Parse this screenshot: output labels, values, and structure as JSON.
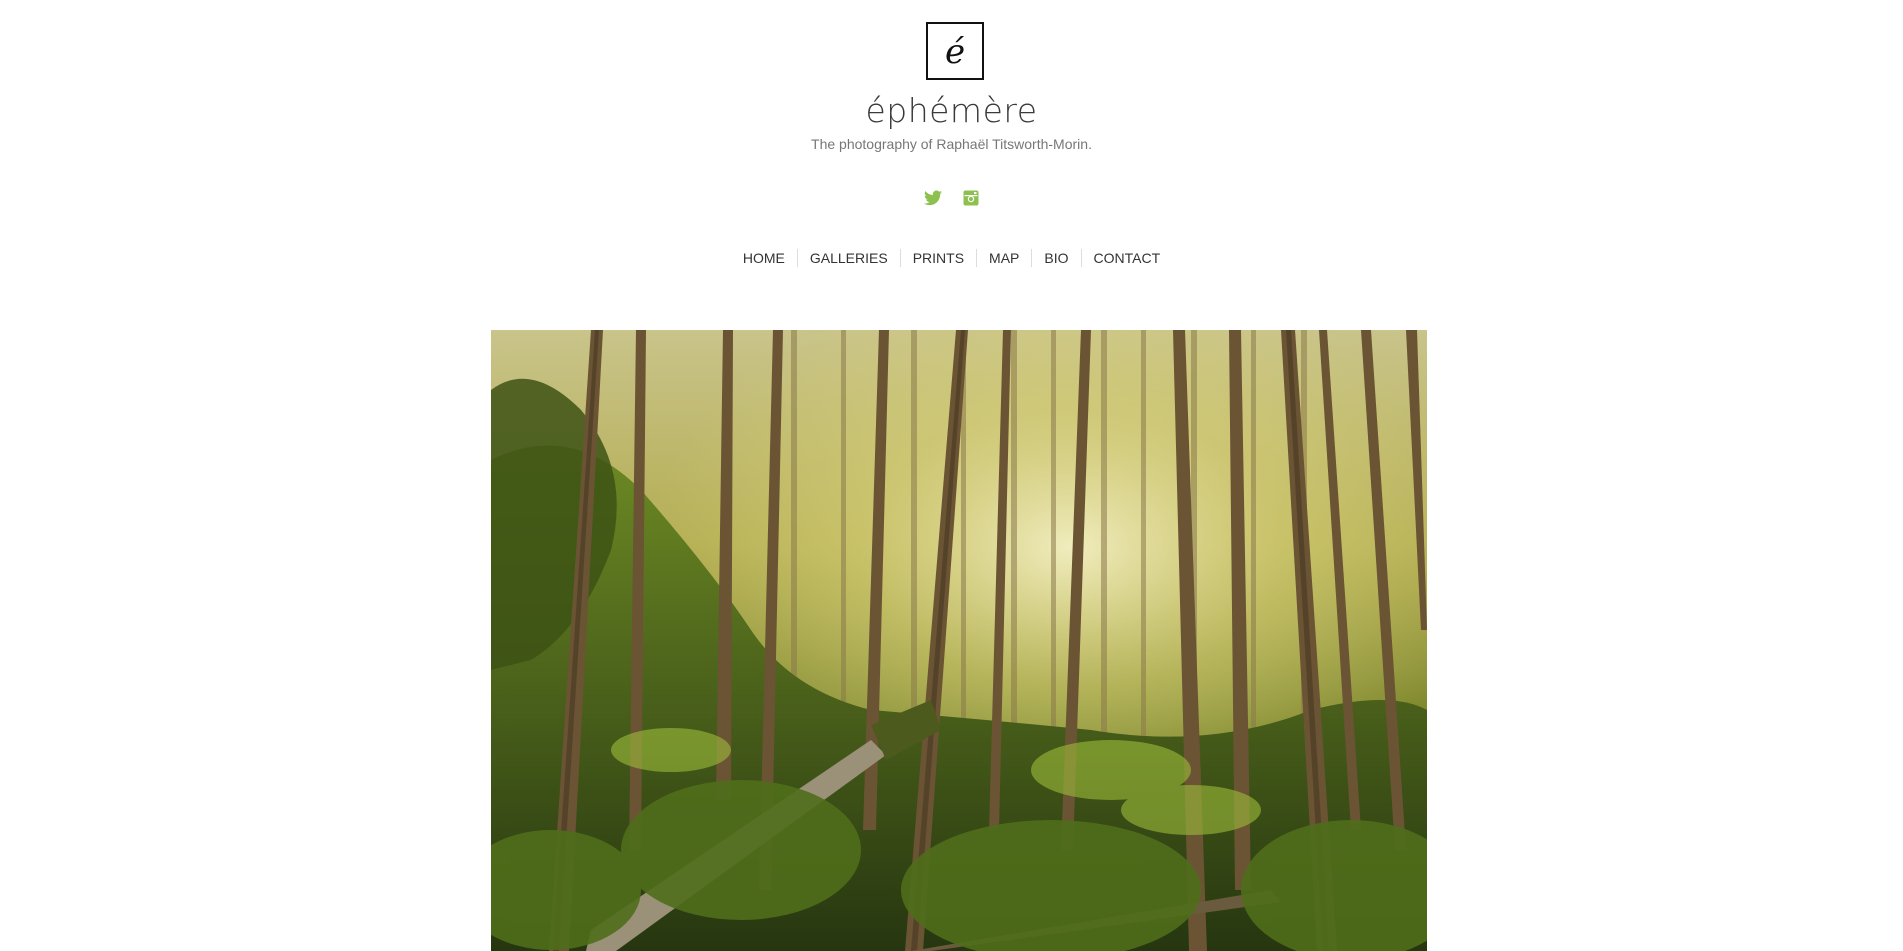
{
  "site": {
    "logo_letter": "é",
    "title": "éphémère",
    "tagline": "The photography of Raphaël Titsworth-Morin."
  },
  "social": [
    {
      "name": "twitter",
      "icon": "twitter-icon"
    },
    {
      "name": "instagram",
      "icon": "instagram-icon"
    }
  ],
  "nav": {
    "items": [
      {
        "label": "HOME"
      },
      {
        "label": "GALLERIES"
      },
      {
        "label": "PRINTS"
      },
      {
        "label": "MAP"
      },
      {
        "label": "BIO"
      },
      {
        "label": "CONTACT"
      }
    ]
  },
  "hero": {
    "subject": "sunlit forest of tall conifers on a mossy slope with a fallen log"
  },
  "colors": {
    "accent": "#8cc04f",
    "text": "#333333",
    "muted": "#777777"
  }
}
